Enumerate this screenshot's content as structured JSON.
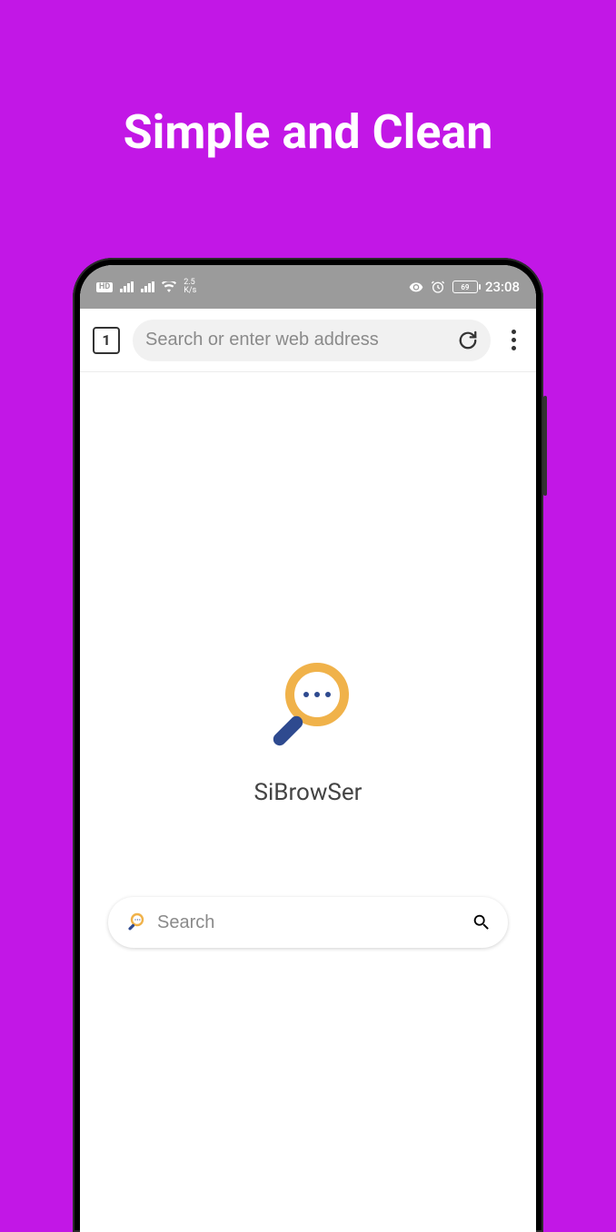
{
  "promo": {
    "title": "Simple and Clean"
  },
  "status_bar": {
    "hd_label": "HD",
    "net_speed": {
      "value": "2.5",
      "unit": "K/s"
    },
    "battery": "69",
    "time": "23:08"
  },
  "toolbar": {
    "tab_count": "1",
    "address_placeholder": "Search or enter web address"
  },
  "content": {
    "app_name": "SiBrowSer",
    "search_placeholder": "Search"
  },
  "colors": {
    "background": "#c217e6",
    "logo_ring": "#f0b24a",
    "logo_handle": "#2e4a8f",
    "logo_dots": "#2e4a8f"
  }
}
